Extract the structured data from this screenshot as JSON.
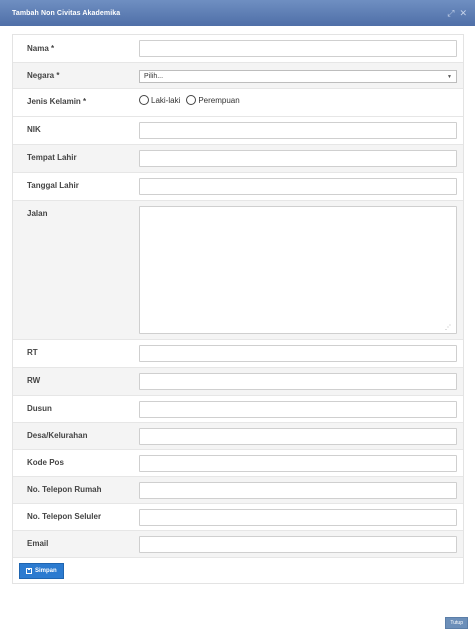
{
  "modal": {
    "title": "Tambah Non Civitas Akademika",
    "maximize_icon": "expand-icon",
    "close_icon": "close-icon"
  },
  "form": {
    "nama_label": "Nama *",
    "negara_label": "Negara *",
    "negara_selected": "Pilih...",
    "jenis_kelamin_label": "Jenis Kelamin *",
    "gender_option_1": "Laki-laki",
    "gender_option_2": "Perempuan",
    "nik_label": "NIK",
    "tempat_lahir_label": "Tempat Lahir",
    "tanggal_lahir_label": "Tanggal Lahir",
    "jalan_label": "Jalan",
    "rt_label": "RT",
    "rw_label": "RW",
    "dusun_label": "Dusun",
    "desa_label": "Desa/Kelurahan",
    "kode_pos_label": "Kode Pos",
    "telepon_rumah_label": "No. Telepon Rumah",
    "telepon_seluler_label": "No. Telepon Seluler",
    "email_label": "Email"
  },
  "buttons": {
    "save_label": "Simpan",
    "save_icon": "floppy-disk-icon",
    "close_label": "Tutup"
  }
}
